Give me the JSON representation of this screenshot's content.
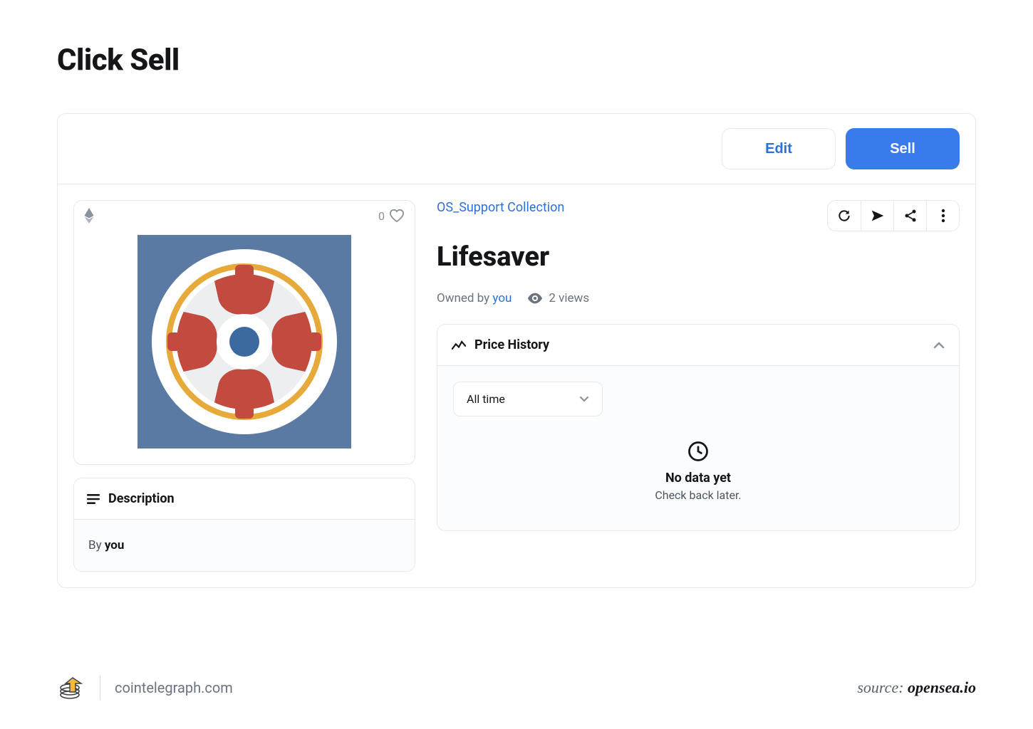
{
  "page": {
    "title": "Click Sell"
  },
  "topbar": {
    "edit": "Edit",
    "sell": "Sell"
  },
  "media": {
    "likes": "0"
  },
  "description": {
    "heading": "Description",
    "by_prefix": "By ",
    "by_value": "you"
  },
  "asset": {
    "collection": "OS_Support Collection",
    "title": "Lifesaver",
    "owned_prefix": "Owned by ",
    "owner": "you",
    "views": "2 views"
  },
  "price_history": {
    "heading": "Price History",
    "range": "All time",
    "empty_title": "No data yet",
    "empty_sub": "Check back later."
  },
  "footer": {
    "site": "cointelegraph.com",
    "source_prefix": "source: ",
    "source": "opensea.io"
  }
}
